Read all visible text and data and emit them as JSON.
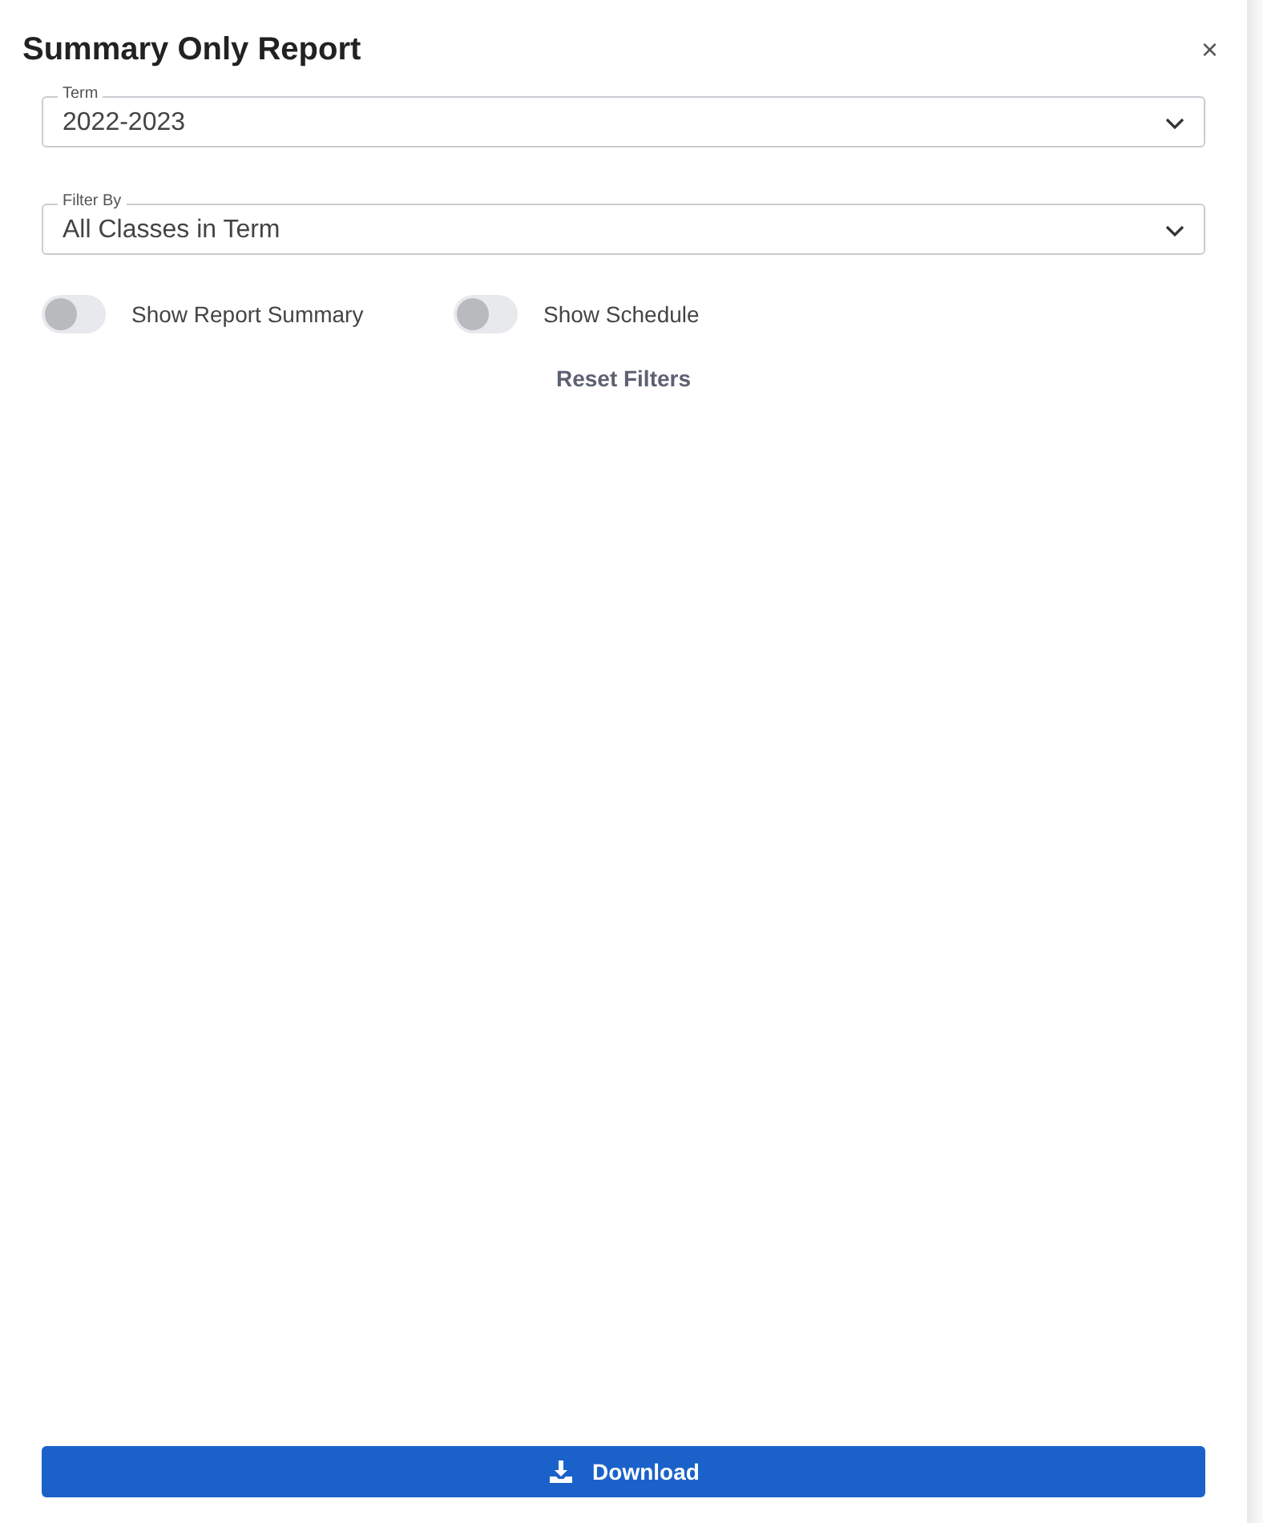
{
  "dialog": {
    "title": "Summary Only Report",
    "close": "×"
  },
  "fields": [
    {
      "label": "Term",
      "value": "2022-2023"
    },
    {
      "label": "Filter By",
      "value": "All Classes in Term"
    }
  ],
  "toggles": [
    {
      "label": "Show Report Summary",
      "on": false
    },
    {
      "label": "Show Schedule",
      "on": false
    }
  ],
  "reset_link": "Reset Filters",
  "download_button": "Download"
}
